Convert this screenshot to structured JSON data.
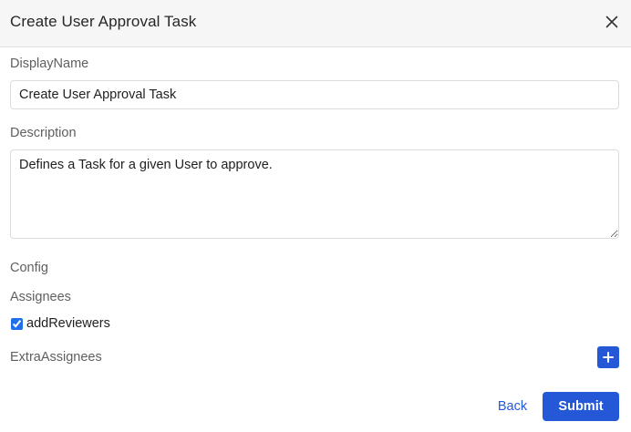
{
  "dialog": {
    "title": "Create User Approval Task",
    "close_icon": "close-icon"
  },
  "form": {
    "display_name_label": "DisplayName",
    "display_name_value": "Create User Approval Task",
    "description_label": "Description",
    "description_value": "Defines a Task for a given User to approve.",
    "config_label": "Config",
    "assignees_label": "Assignees",
    "add_reviewers_label": "addReviewers",
    "add_reviewers_checked": true,
    "extra_assignees_label": "ExtraAssignees",
    "add_icon": "plus-icon"
  },
  "footer": {
    "back_label": "Back",
    "submit_label": "Submit"
  },
  "colors": {
    "accent": "#2458d6",
    "header_bg": "#f6f6f6"
  }
}
